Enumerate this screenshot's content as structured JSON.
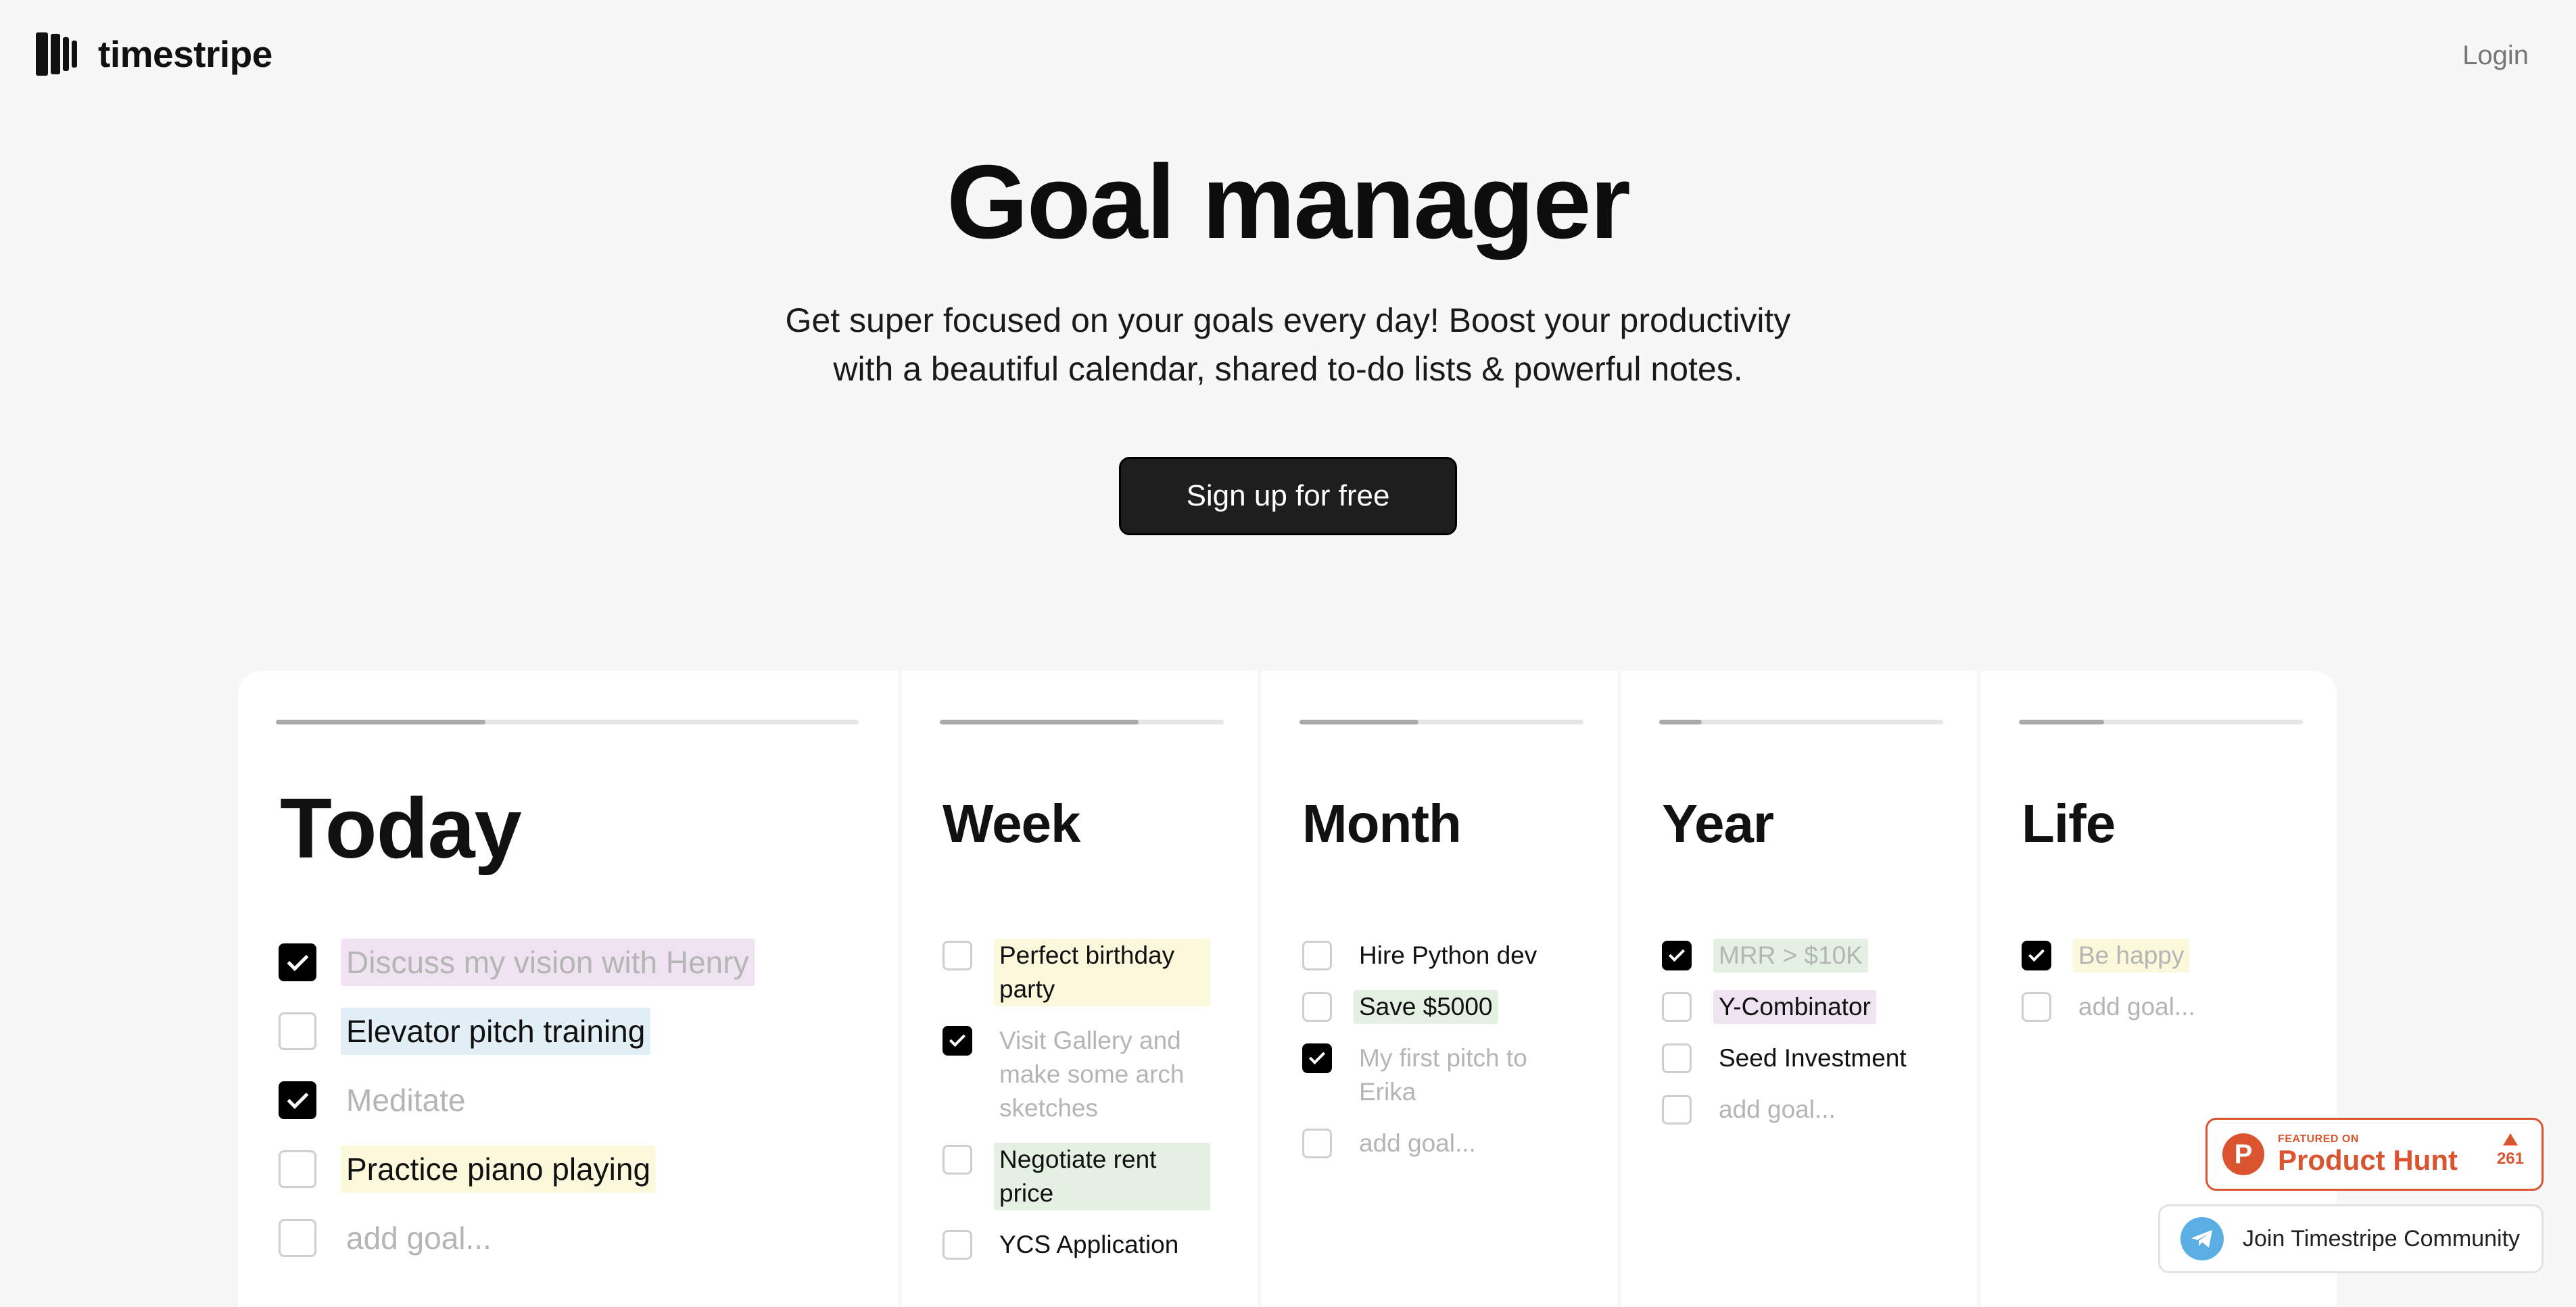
{
  "header": {
    "brand": "timestripe",
    "login_label": "Login"
  },
  "hero": {
    "title": "Goal manager",
    "subtitle_line1": "Get super focused on your goals every day! Boost your productivity",
    "subtitle_line2": "with a beautiful calendar, shared to-do lists & powerful notes.",
    "cta_label": "Sign up for free"
  },
  "columns": {
    "today": {
      "title": "Today",
      "progress": 0.36,
      "items": [
        {
          "text": "Discuss my vision with Henry",
          "checked": true,
          "highlight": "purple"
        },
        {
          "text": "Elevator pitch training",
          "checked": false,
          "highlight": "blue"
        },
        {
          "text": "Meditate",
          "checked": true,
          "highlight": "none"
        },
        {
          "text": "Practice piano playing",
          "checked": false,
          "highlight": "yellow"
        },
        {
          "text": "add goal...",
          "checked": false,
          "highlight": "none",
          "placeholder": true
        }
      ]
    },
    "week": {
      "title": "Week",
      "progress": 0.7,
      "items": [
        {
          "text": "Perfect birthday party",
          "checked": false,
          "highlight": "yellow"
        },
        {
          "text": "Visit Gallery and make some arch sketches",
          "checked": true,
          "highlight": "none"
        },
        {
          "text": "Negotiate rent price",
          "checked": false,
          "highlight": "green"
        },
        {
          "text": "YCS Application",
          "checked": false,
          "highlight": "none"
        }
      ]
    },
    "month": {
      "title": "Month",
      "progress": 0.42,
      "items": [
        {
          "text": "Hire Python dev",
          "checked": false,
          "highlight": "none"
        },
        {
          "text": "Save $5000",
          "checked": false,
          "highlight": "green"
        },
        {
          "text": "My first pitch to Erika",
          "checked": true,
          "highlight": "none"
        },
        {
          "text": "add goal...",
          "checked": false,
          "highlight": "none",
          "placeholder": true
        }
      ]
    },
    "year": {
      "title": "Year",
      "progress": 0.15,
      "items": [
        {
          "text": "MRR > $10K",
          "checked": true,
          "highlight": "green"
        },
        {
          "text": "Y-Combinator",
          "checked": false,
          "highlight": "purple"
        },
        {
          "text": "Seed Investment",
          "checked": false,
          "highlight": "none"
        },
        {
          "text": "add goal...",
          "checked": false,
          "highlight": "none",
          "placeholder": true
        }
      ]
    },
    "life": {
      "title": "Life",
      "progress": 0.3,
      "items": [
        {
          "text": "Be happy",
          "checked": true,
          "highlight": "yellow"
        },
        {
          "text": "add goal...",
          "checked": false,
          "highlight": "none",
          "placeholder": true
        }
      ]
    }
  },
  "widgets": {
    "product_hunt": {
      "small_label": "FEATURED ON",
      "big_label": "Product Hunt",
      "votes": "261",
      "logo_letter": "P"
    },
    "telegram": {
      "label": "Join Timestripe Community",
      "icon": "telegram-icon"
    }
  }
}
